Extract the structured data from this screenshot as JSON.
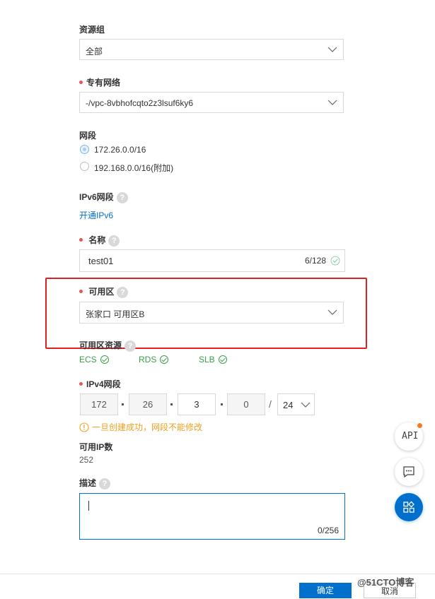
{
  "resource_group": {
    "label": "资源组",
    "value": "全部"
  },
  "vpc": {
    "label": "专有网络",
    "value": "-/vpc-8vbhofcqto2z3lsuf6ky6"
  },
  "segment": {
    "label": "网段",
    "options": [
      {
        "label": "172.26.0.0/16",
        "checked": true
      },
      {
        "label": "192.168.0.0/16(附加)",
        "checked": false
      }
    ]
  },
  "ipv6": {
    "label": "IPv6网段",
    "link": "开通IPv6"
  },
  "name_field": {
    "label": "名称",
    "value": "test01",
    "counter": "6/128"
  },
  "zone": {
    "label": "可用区",
    "value": "张家口 可用区B"
  },
  "zone_resources": {
    "label": "可用区资源",
    "items": [
      "ECS",
      "RDS",
      "SLB"
    ]
  },
  "ipv4": {
    "label": "IPv4网段",
    "octets": [
      "172",
      "26",
      "3",
      "0"
    ],
    "slash": "/",
    "mask": "24",
    "warning": "一旦创建成功，网段不能修改"
  },
  "available_ip": {
    "label": "可用IP数",
    "value": "252"
  },
  "description": {
    "label": "描述",
    "counter": "0/256"
  },
  "side_tools": {
    "api_label": "API"
  },
  "footer": {
    "confirm_label": "确定",
    "cancel_label": "取消"
  },
  "watermark": "@51CTO博客",
  "colors": {
    "accent": "#0070cc",
    "required_dot": "#e65757",
    "success": "#3aa04a",
    "warning": "#f0a020",
    "highlight_box": "#e02020"
  },
  "help_icon_text": "?"
}
